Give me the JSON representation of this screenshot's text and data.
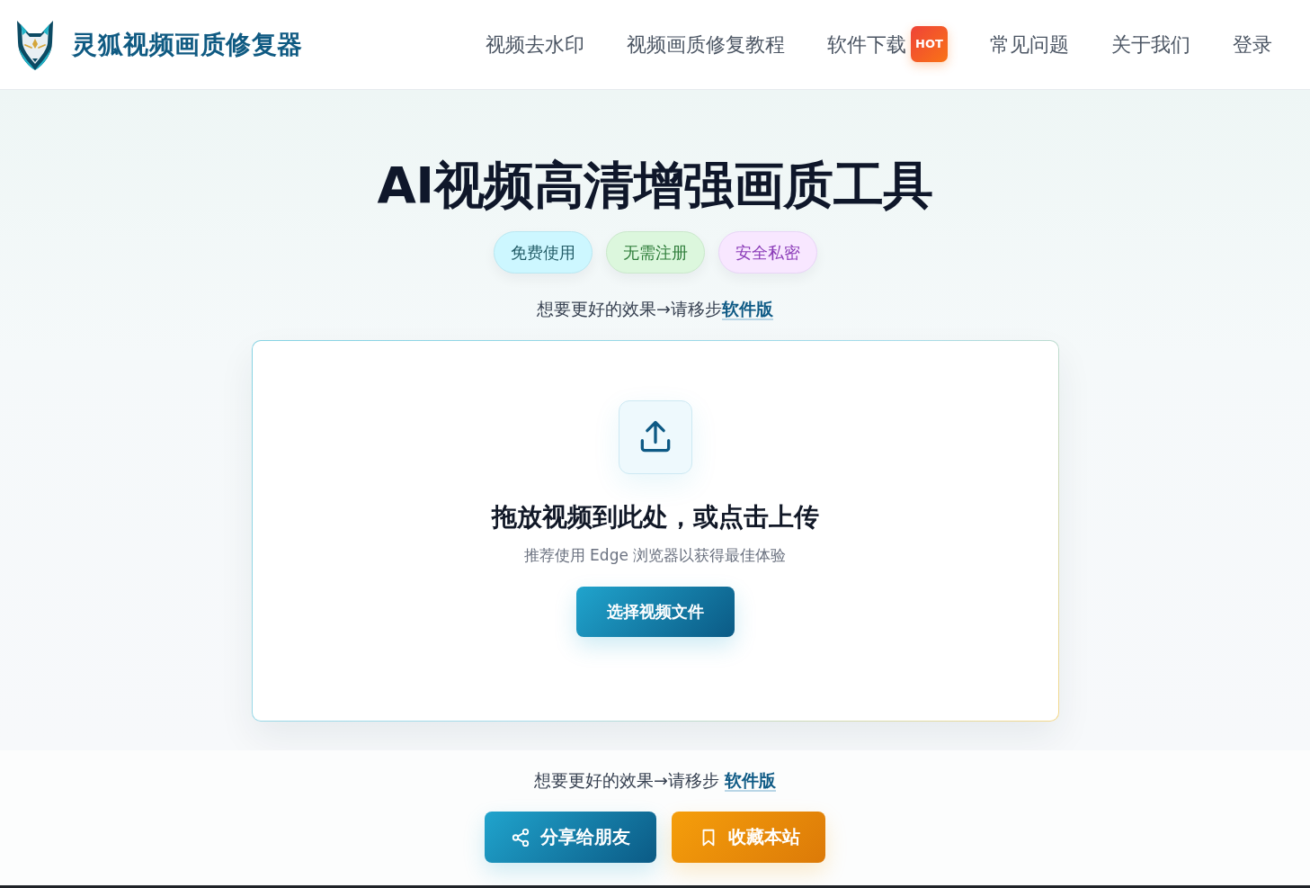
{
  "header": {
    "logo_title": "灵狐视频画质修复器",
    "nav": [
      {
        "label": "视频去水印"
      },
      {
        "label": "视频画质修复教程"
      },
      {
        "label": "软件下载",
        "badge": "HOT"
      },
      {
        "label": "常见问题"
      },
      {
        "label": "关于我们"
      },
      {
        "label": "登录"
      }
    ]
  },
  "hero": {
    "title": "AI视频高清增强画质工具",
    "tags": [
      {
        "label": "免费使用",
        "color": "#245e69"
      },
      {
        "label": "无需注册",
        "color": "#2e7d3a"
      },
      {
        "label": "安全私密",
        "color": "#8b3cb8"
      }
    ],
    "promo": {
      "text": "想要更好的效果→请移步",
      "link": "软件版"
    }
  },
  "upload": {
    "title": "拖放视频到此处，或点击上传",
    "hint": "推荐使用 Edge 浏览器以获得最佳体验",
    "button": "选择视频文件"
  },
  "footer_promo": {
    "text": "想要更好的效果→请移步",
    "link": "软件版"
  },
  "actions": [
    {
      "kind": "share",
      "label": "分享给朋友"
    },
    {
      "kind": "bookmark",
      "label": "收藏本站"
    }
  ]
}
